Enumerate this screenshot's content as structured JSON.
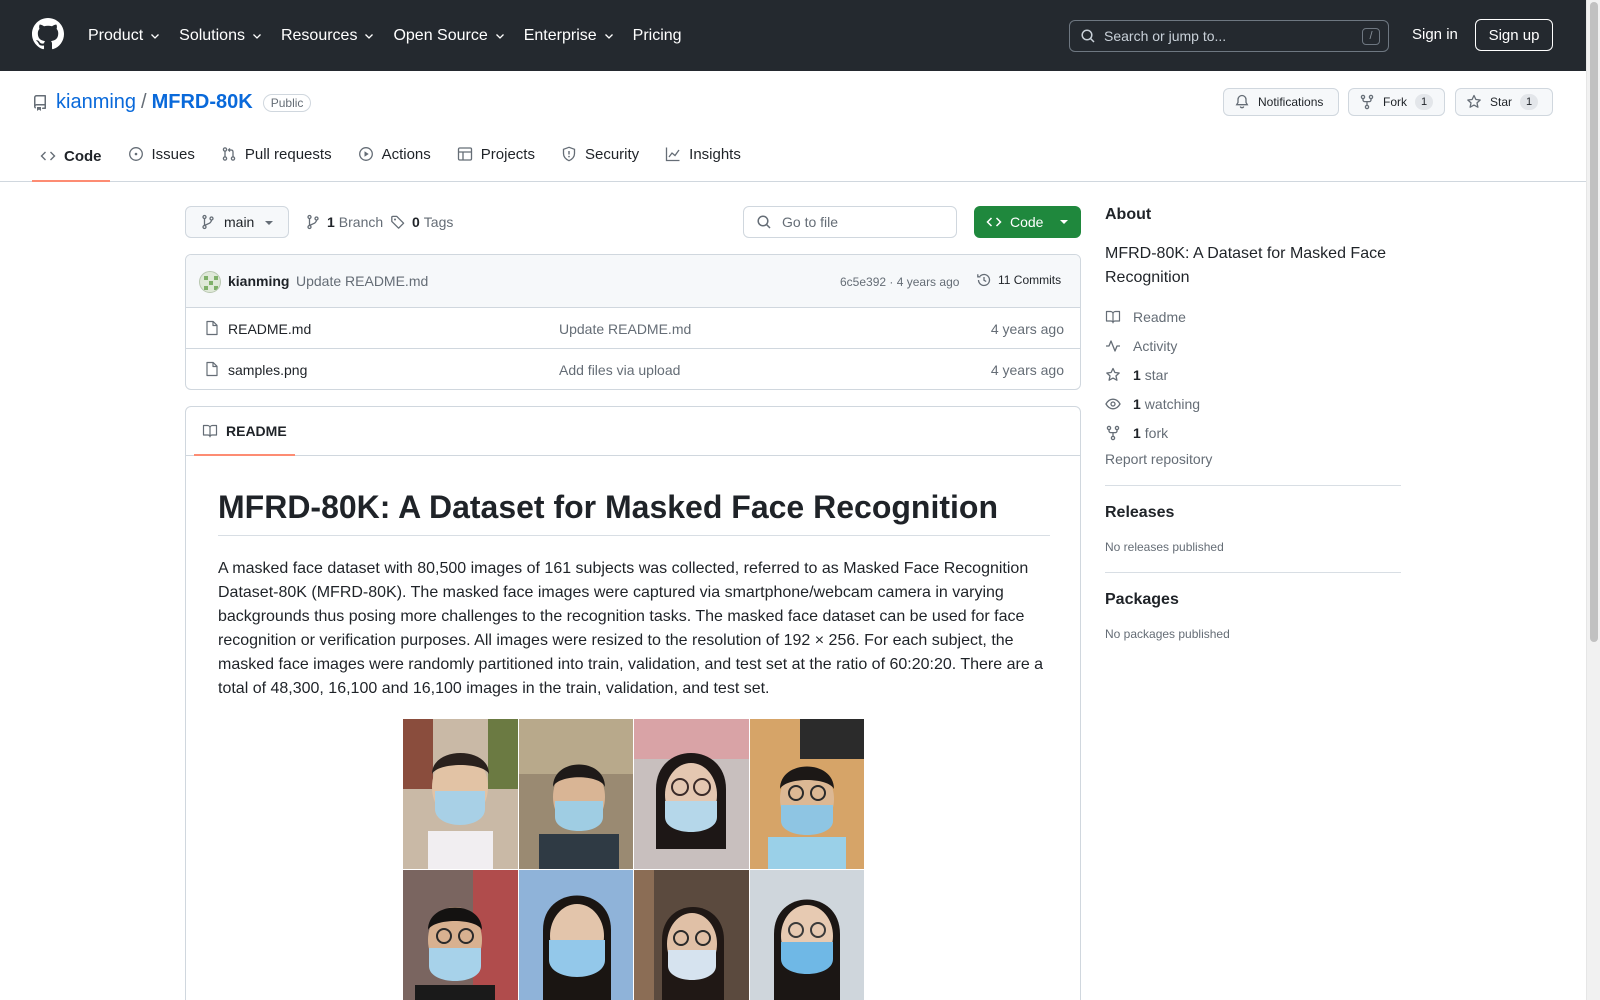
{
  "header": {
    "nav": [
      {
        "label": "Product",
        "dropdown": true
      },
      {
        "label": "Solutions",
        "dropdown": true
      },
      {
        "label": "Resources",
        "dropdown": true
      },
      {
        "label": "Open Source",
        "dropdown": true
      },
      {
        "label": "Enterprise",
        "dropdown": true
      },
      {
        "label": "Pricing",
        "dropdown": false
      }
    ],
    "search_placeholder": "Search or jump to...",
    "search_shortcut": "/",
    "sign_in": "Sign in",
    "sign_up": "Sign up"
  },
  "repo": {
    "owner": "kianming",
    "separator": "/",
    "name": "MFRD-80K",
    "visibility": "Public",
    "notifications_label": "Notifications",
    "fork_label": "Fork",
    "fork_count": "1",
    "star_label": "Star",
    "star_count": "1"
  },
  "tabs": [
    {
      "label": "Code",
      "icon": "code-icon",
      "active": true
    },
    {
      "label": "Issues",
      "icon": "issue-icon",
      "active": false
    },
    {
      "label": "Pull requests",
      "icon": "pull-request-icon",
      "active": false
    },
    {
      "label": "Actions",
      "icon": "play-icon",
      "active": false
    },
    {
      "label": "Projects",
      "icon": "table-icon",
      "active": false
    },
    {
      "label": "Security",
      "icon": "shield-icon",
      "active": false
    },
    {
      "label": "Insights",
      "icon": "graph-icon",
      "active": false
    }
  ],
  "toolbar": {
    "branch": "main",
    "branch_count": "1",
    "branch_label": "Branch",
    "tag_count": "0",
    "tag_label": "Tags",
    "goto_placeholder": "Go to file",
    "code_button": "Code"
  },
  "latest_commit": {
    "author": "kianming",
    "message": "Update README.md",
    "hash_age": "6c5e392 · 4 years ago",
    "commits": "11 Commits"
  },
  "files": [
    {
      "name": "README.md",
      "message": "Update README.md",
      "age": "4 years ago"
    },
    {
      "name": "samples.png",
      "message": "Add files via upload",
      "age": "4 years ago"
    }
  ],
  "readme": {
    "tab_label": "README",
    "title": "MFRD-80K: A Dataset for Masked Face Recognition",
    "body": "A masked face dataset with 80,500 images of 161 subjects was collected, referred to as Masked Face Recognition Dataset-80K (MFRD-80K). The masked face images were captured via smartphone/webcam camera in varying backgrounds thus posing more challenges to the recognition tasks. The masked face dataset can be used for face recognition or verification purposes. All images were resized to the resolution of 192 × 256. For each subject, the masked face images were randomly partitioned into train, validation, and test set at the ratio of 60:20:20. There are a total of 48,300, 16,100 and 16,100 images in the train, validation, and test set."
  },
  "about": {
    "heading": "About",
    "description": "MFRD-80K: A Dataset for Masked Face Recognition",
    "readme": "Readme",
    "activity": "Activity",
    "stars_count": "1",
    "stars_label": "star",
    "watching_count": "1",
    "watching_label": "watching",
    "forks_count": "1",
    "forks_label": "fork",
    "report": "Report repository"
  },
  "releases": {
    "heading": "Releases",
    "empty": "No releases published"
  },
  "packages": {
    "heading": "Packages",
    "empty": "No packages published"
  },
  "colors": {
    "header_bg": "#24292f",
    "link": "#0969da",
    "primary_button": "#1f883d",
    "active_tab_underline": "#fd8c73"
  }
}
